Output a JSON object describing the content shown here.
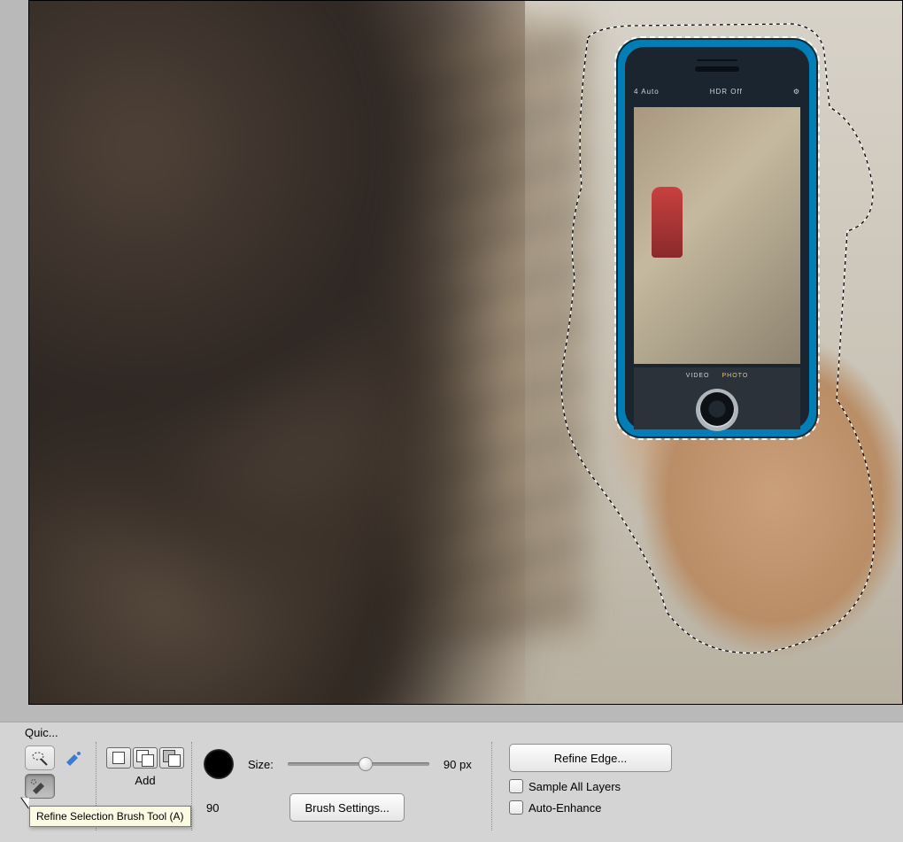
{
  "panel": {
    "title": "Quic...",
    "modeLabel": "Add",
    "sizeLabel": "Size:",
    "sizeValue": "90 px",
    "sizeNumber": "90",
    "brushSettings": "Brush Settings...",
    "refineEdge": "Refine Edge...",
    "sampleAllLayers": "Sample All Layers",
    "autoEnhance": "Auto-Enhance"
  },
  "slider": {
    "min": 1,
    "max": 300,
    "value": 90,
    "thumbLeftPx": 80
  },
  "tooltip": "Refine Selection Brush Tool (A)",
  "phone": {
    "left": "4 Auto",
    "center": "HDR Off",
    "videoLabel": "VIDEO",
    "photoLabel": "PHOTO"
  },
  "icons": {
    "wand": "quick-selection-wand-icon",
    "brushBlue": "selection-brush-icon",
    "refine": "refine-selection-brush-icon"
  }
}
